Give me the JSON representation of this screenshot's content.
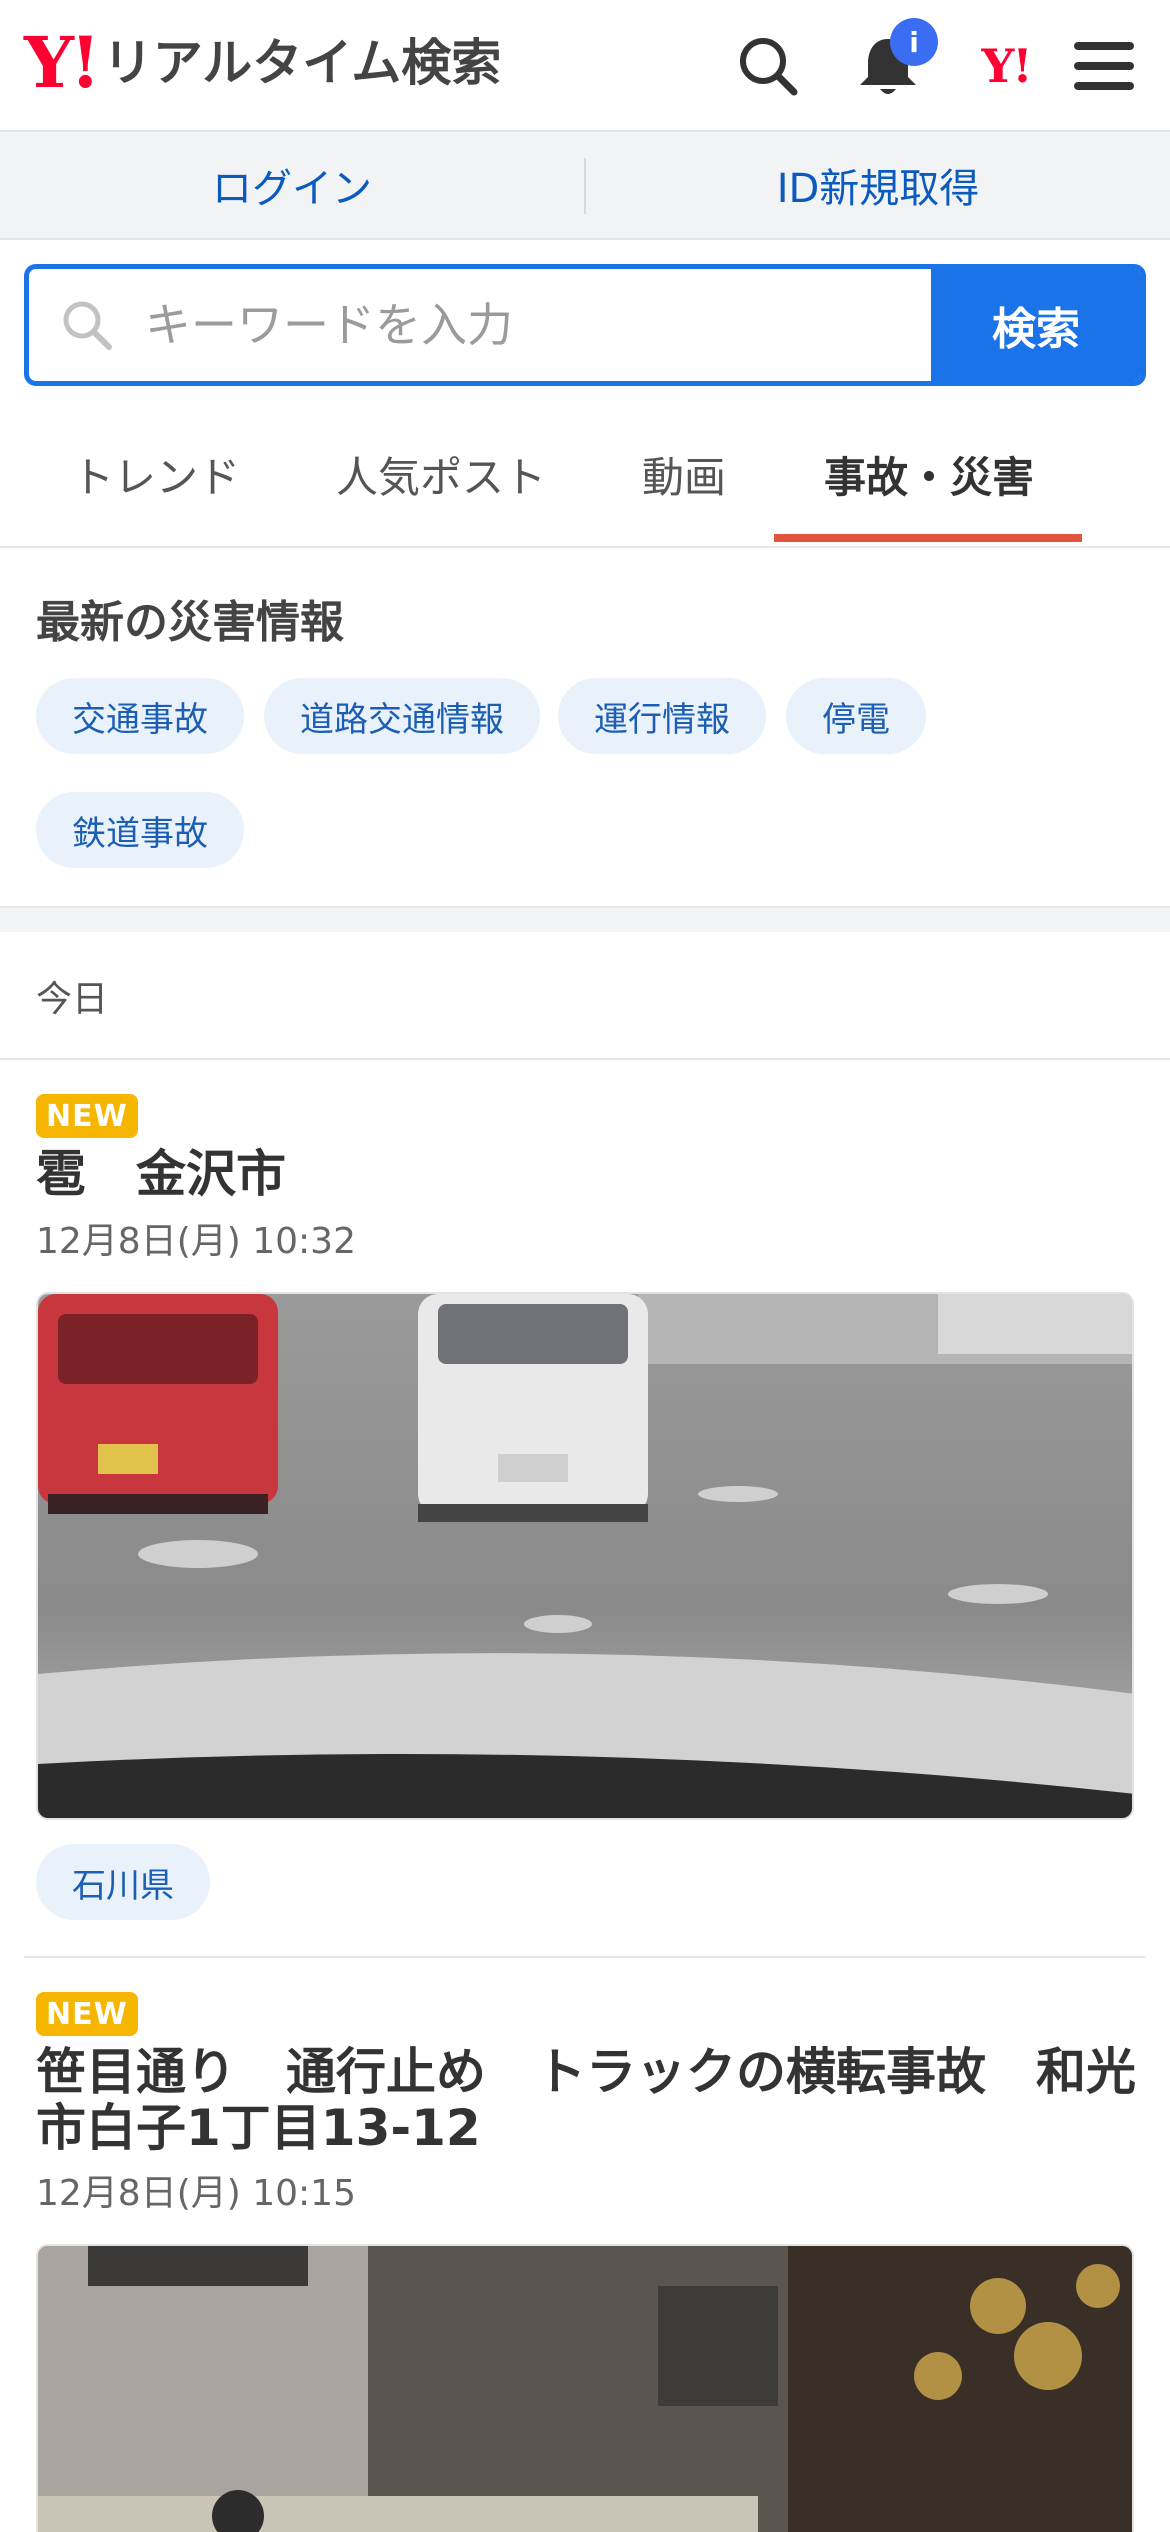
{
  "header": {
    "logo_mark": "Y!",
    "logo_text": "リアルタイム検索",
    "notification_badge": "i",
    "yahoo_small": "Y!"
  },
  "loginbar": {
    "login": "ログイン",
    "register": "ID新規取得"
  },
  "search": {
    "placeholder": "キーワードを入力",
    "button": "検索"
  },
  "tabs": [
    {
      "label": "トレンド",
      "active": false
    },
    {
      "label": "人気ポスト",
      "active": false
    },
    {
      "label": "動画",
      "active": false
    },
    {
      "label": "事故・災害",
      "active": true
    }
  ],
  "disaster": {
    "title": "最新の災害情報",
    "chips": [
      "交通事故",
      "道路交通情報",
      "運行情報",
      "停電",
      "鉄道事故"
    ]
  },
  "today_label": "今日",
  "posts": [
    {
      "badge": "NEW",
      "title": "雹　金沢市",
      "time": "12月8日(月) 10:32",
      "location": "石川県"
    },
    {
      "badge": "NEW",
      "title": "笹目通り　通行止め　トラックの横転事故　和光市白子1丁目13-12",
      "time": "12月8日(月) 10:15"
    }
  ],
  "colors": {
    "accent": "#1a73e8",
    "tab_underline": "#e0553b",
    "new_badge": "#f6b500",
    "chip_bg": "#e9f1fb",
    "chip_text": "#1b5eb4",
    "brand_red": "#ff0033"
  },
  "icons": [
    "search-icon",
    "bell-icon",
    "menu-icon"
  ]
}
